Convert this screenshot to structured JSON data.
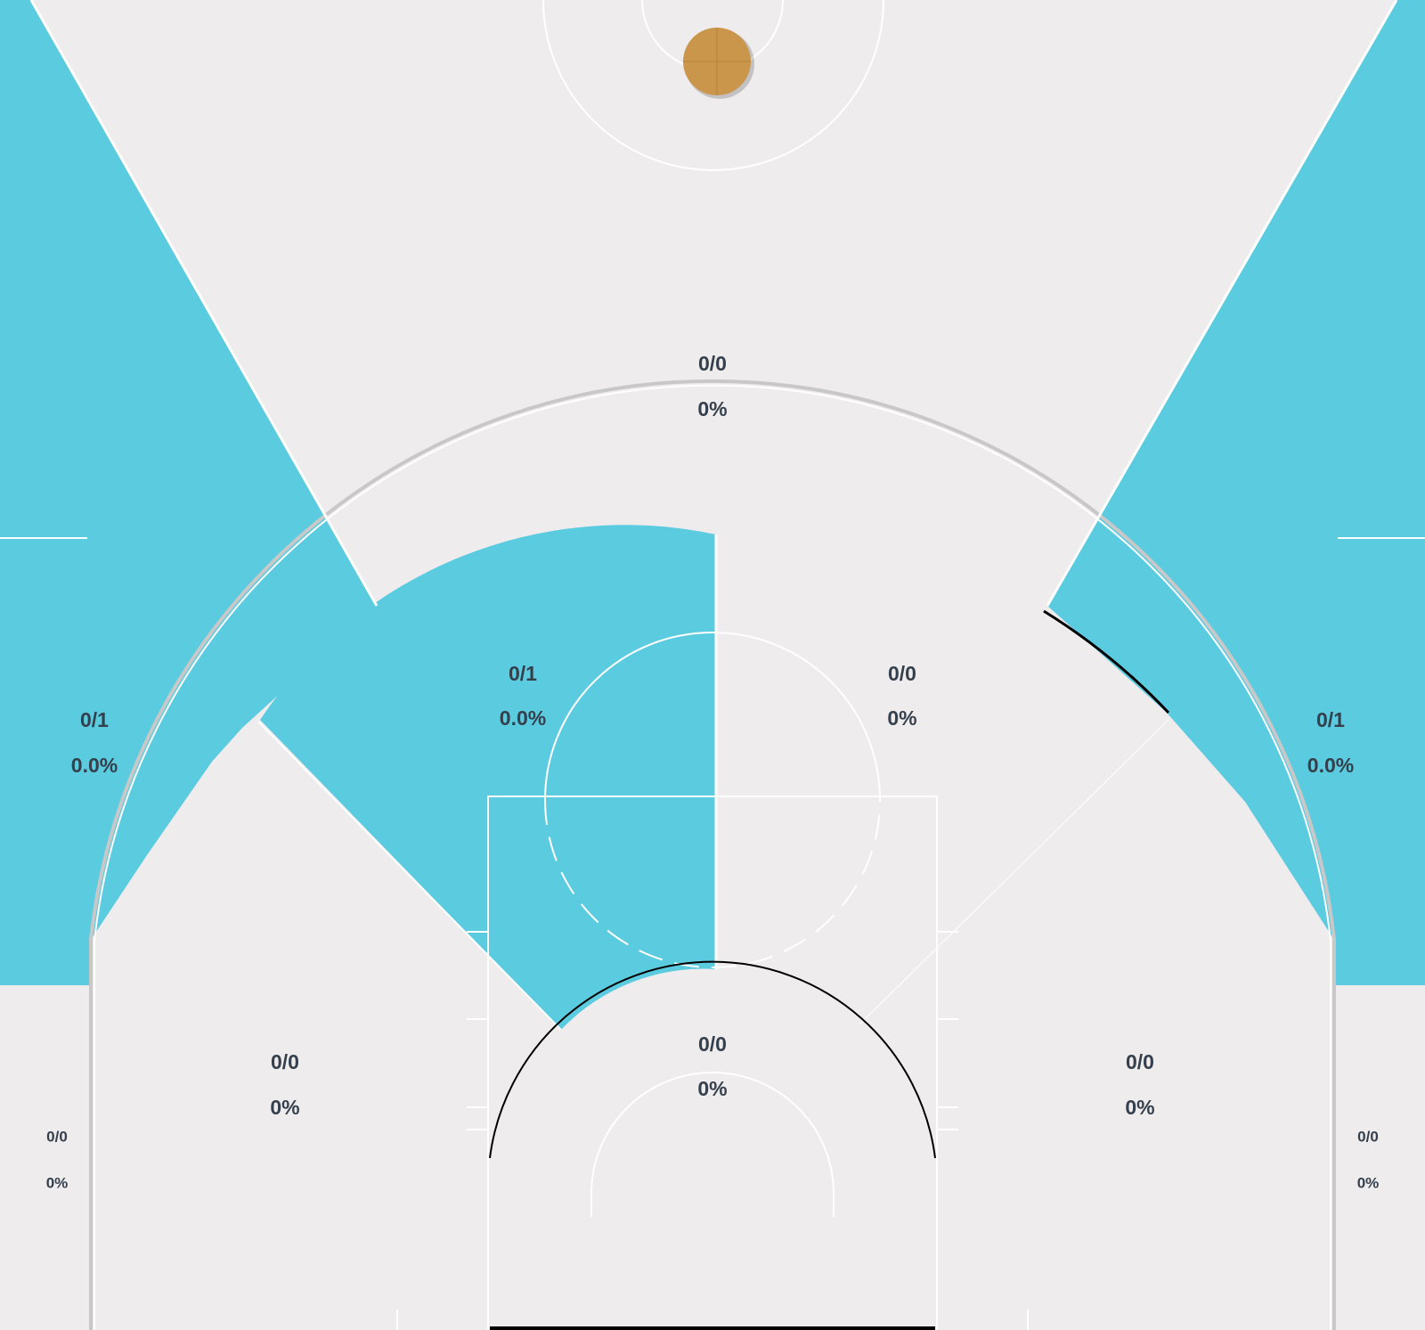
{
  "colors": {
    "court": "#efecee",
    "hot_zone": "#5bcbe0",
    "lines": "#ffffff",
    "text": "#35404c",
    "ball": "#c9964c"
  },
  "zones": {
    "top_three": {
      "made_attempts": "0/0",
      "pct": "0%"
    },
    "left_wing_three": {
      "made_attempts": "0/1",
      "pct": "0.0%"
    },
    "right_wing_three": {
      "made_attempts": "0/1",
      "pct": "0.0%"
    },
    "left_mid_top": {
      "made_attempts": "0/1",
      "pct": "0.0%"
    },
    "right_mid_top": {
      "made_attempts": "0/0",
      "pct": "0%"
    },
    "left_mid_low": {
      "made_attempts": "0/0",
      "pct": "0%"
    },
    "right_mid_low": {
      "made_attempts": "0/0",
      "pct": "0%"
    },
    "paint": {
      "made_attempts": "0/0",
      "pct": "0%"
    },
    "left_corner_three": {
      "made_attempts": "0/0",
      "pct": "0%"
    },
    "right_corner_three": {
      "made_attempts": "0/0",
      "pct": "0%"
    }
  },
  "icons": {
    "ball": "basketball-icon"
  }
}
